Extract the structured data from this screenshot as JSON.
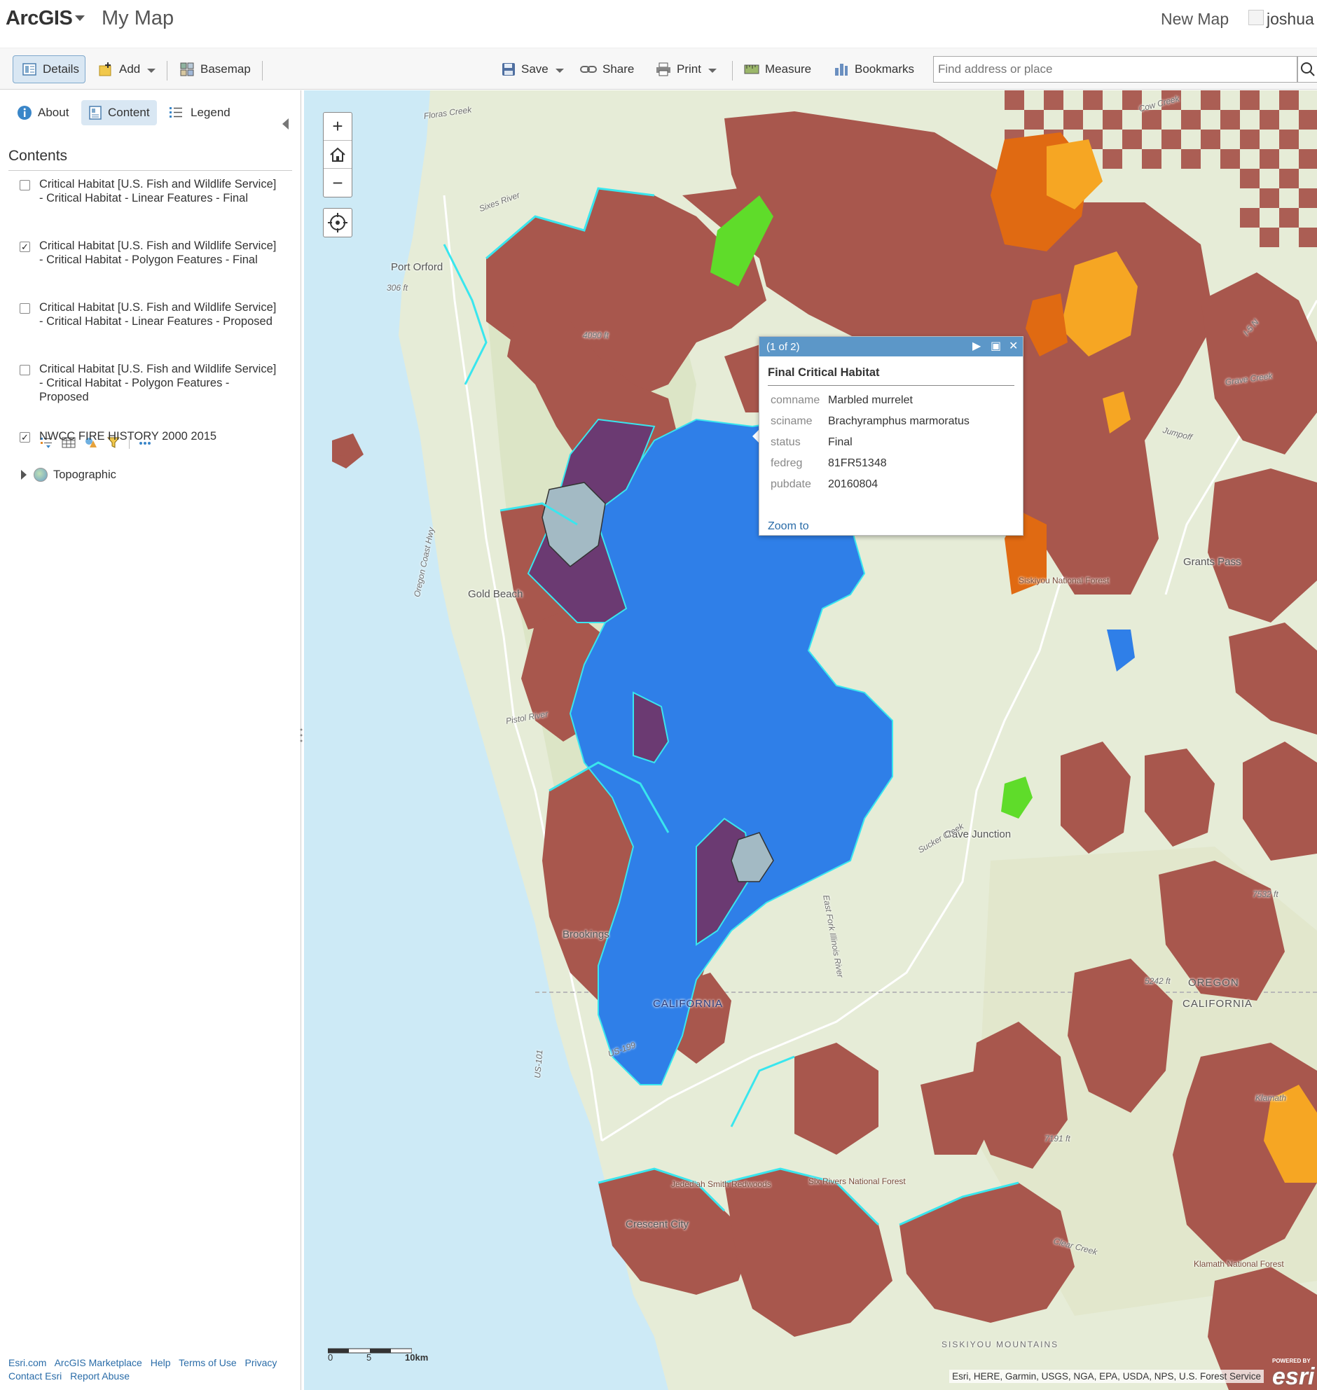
{
  "header": {
    "brand": "ArcGIS",
    "map_title": "My Map",
    "new_map": "New Map",
    "user": "joshua"
  },
  "toolbar": {
    "details": "Details",
    "add": "Add",
    "basemap": "Basemap",
    "save": "Save",
    "share": "Share",
    "print": "Print",
    "measure": "Measure",
    "bookmarks": "Bookmarks",
    "search_placeholder": "Find address or place"
  },
  "sidebar": {
    "tabs": {
      "about": "About",
      "content": "Content",
      "legend": "Legend"
    },
    "contents_title": "Contents",
    "layers": [
      {
        "label": "Critical Habitat [U.S. Fish and Wildlife Service] - Critical Habitat - Linear Features - Final",
        "checked": false
      },
      {
        "label": "Critical Habitat [U.S. Fish and Wildlife Service] - Critical Habitat - Polygon Features - Final",
        "checked": true
      },
      {
        "label": "Critical Habitat [U.S. Fish and Wildlife Service] - Critical Habitat - Linear Features - Proposed",
        "checked": false
      },
      {
        "label": "Critical Habitat [U.S. Fish and Wildlife Service] - Critical Habitat - Polygon Features - Proposed",
        "checked": false
      },
      {
        "label": "NWCC FIRE HISTORY 2000 2015",
        "checked": true
      }
    ],
    "basemap_layer": "Topographic",
    "footer": {
      "esri": "Esri.com",
      "marketplace": "ArcGIS Marketplace",
      "help": "Help",
      "terms": "Terms of Use",
      "privacy": "Privacy",
      "contact": "Contact Esri",
      "report": "Report Abuse"
    }
  },
  "popup": {
    "counter": "(1 of 2)",
    "title": "Final Critical Habitat",
    "attributes": [
      {
        "key": "comname",
        "value": "Marbled murrelet"
      },
      {
        "key": "sciname",
        "value": "Brachyramphus marmoratus"
      },
      {
        "key": "status",
        "value": "Final"
      },
      {
        "key": "fedreg",
        "value": "81FR51348"
      },
      {
        "key": "pubdate",
        "value": "20160804"
      }
    ],
    "zoom_to": "Zoom to"
  },
  "map_labels": {
    "port_orford": "Port Orford",
    "gold_beach": "Gold Beach",
    "brookings": "Brookings",
    "crescent_city": "Crescent City",
    "grants_pass": "Grants Pass",
    "cave_junction": "Cave Junction",
    "oregon": "OREGON",
    "california": "CALIFORNIA",
    "siskiyou_nf": "Siskiyou National Forest",
    "six_rivers_nf": "Six Rivers National Forest",
    "jedediah": "Jedediah Smith Redwoods",
    "klamath_nf": "Klamath National Forest",
    "siskiyou_mtns": "SISKIYOU MOUNTAINS",
    "elev_306": "306 ft",
    "elev_4090": "4090 ft",
    "elev_5242": "5242 ft",
    "elev_7191": "7191 ft",
    "elev_7532": "7532 ft",
    "oregon_coast_hwy": "Oregon Coast Hwy",
    "us101": "US-101",
    "us199": "US-199",
    "i5n": "I-5 N",
    "sixes_river": "Sixes River",
    "pistol_river": "Pistol River",
    "illinois_river": "East Fork Illinois River",
    "sucker_creek": "Sucker Creek",
    "floras_creek": "Floras Creek",
    "cow_creek": "Cow Creek",
    "grave_creek": "Grave Creek",
    "jumpoff": "Jumpoff",
    "klamath": "Klamath",
    "clear_creek": "Clear Creek"
  },
  "scale": {
    "zero": "0",
    "five": "5",
    "ten": "10km"
  },
  "attribution": "Esri, HERE, Garmin, USGS, NGA, EPA, USDA, NPS, U.S. Forest Service",
  "esri_logo": {
    "powered": "POWERED BY",
    "word": "esri"
  },
  "colors": {
    "fire": "#a8574d",
    "habitat_outline": "#39e6ee",
    "habitat_blue": "#2f7fe8",
    "habitat_purple": "#6b3a72",
    "orange": "#f6a623",
    "dark_orange": "#e06a12",
    "green": "#5fdc2a",
    "water": "#cdeaf6",
    "land": "#e6ecd7",
    "accent": "#5c97c8"
  }
}
